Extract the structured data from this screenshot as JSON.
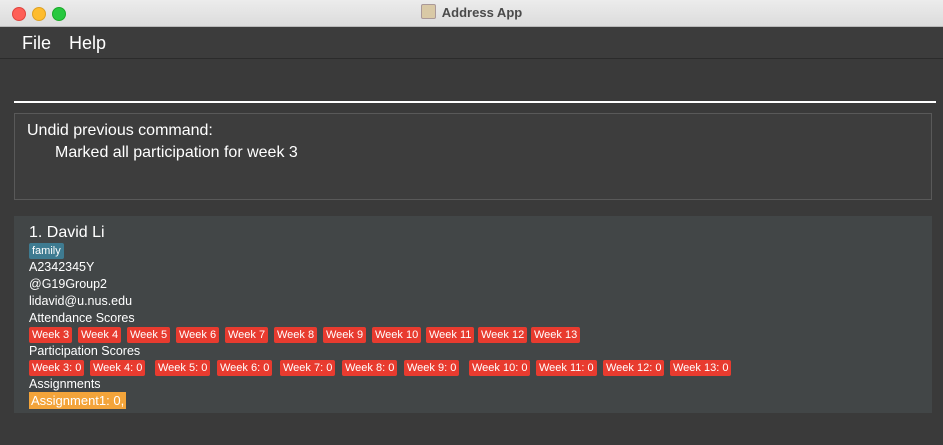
{
  "window": {
    "title": "Address App"
  },
  "menu": {
    "file": "File",
    "help": "Help"
  },
  "command": {
    "value": ""
  },
  "result": {
    "line1": "Undid previous command:",
    "line2": "Marked all participation for week 3"
  },
  "person": {
    "index_name": "1.  David Li",
    "tag": "family",
    "student_id": "A2342345Y",
    "telegram": "@G19Group2",
    "email": "lidavid@u.nus.edu",
    "attendance_label": "Attendance Scores",
    "attendance": [
      "Week 3",
      "Week 4",
      "Week 5",
      "Week 6",
      "Week 7",
      "Week 8",
      "Week 9",
      "Week 10",
      "Week 11",
      "Week 12",
      "Week 13"
    ],
    "participation_label": "Participation Scores",
    "participation": [
      "Week 3: 0",
      "Week 4: 0",
      "Week 5: 0",
      "Week 6: 0",
      "Week 7: 0",
      "Week 8: 0",
      "Week 9: 0",
      "Week 10: 0",
      "Week 11: 0",
      "Week 12: 0",
      "Week 13: 0"
    ],
    "assignments_label": "Assignments",
    "assignment": "Assignment1: 0,"
  },
  "colors": {
    "tag_family": "#3e7b91",
    "score_tag": "#e83b2f",
    "assignment": "#f3a43a"
  }
}
